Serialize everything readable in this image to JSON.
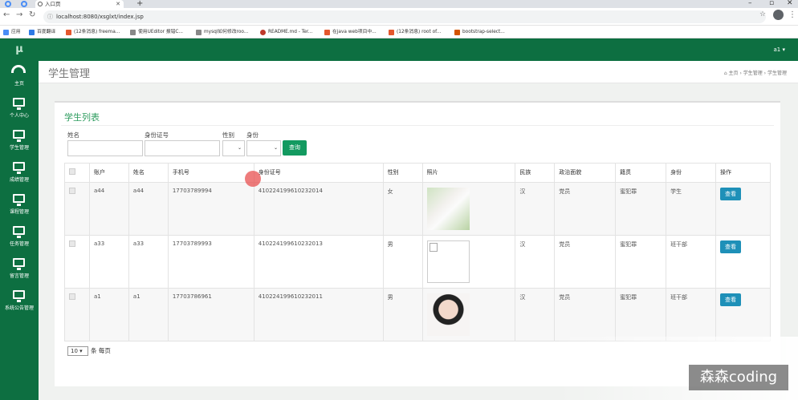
{
  "browser": {
    "tab_title": "入口页",
    "url": "localhost:8080/xsglxt/index.jsp",
    "bookmarks": [
      "应用",
      "百度翻译",
      "(12条消息) freema...",
      "使用UEditor 报错C...",
      "mysql如何修改roo...",
      "README.md - Ter...",
      "在java web项目中...",
      "(12条消息) root of...",
      "bootstrap-select..."
    ]
  },
  "app": {
    "logo": "μ",
    "user": "a1 ▾"
  },
  "sidebar": {
    "items": [
      {
        "label": "主页",
        "icon": "dashboard-icon"
      },
      {
        "label": "个人中心",
        "icon": "monitor-icon"
      },
      {
        "label": "学生管理",
        "icon": "monitor-icon"
      },
      {
        "label": "成绩管理",
        "icon": "monitor-icon"
      },
      {
        "label": "课程管理",
        "icon": "monitor-icon"
      },
      {
        "label": "任务管理",
        "icon": "monitor-icon"
      },
      {
        "label": "留言管理",
        "icon": "monitor-icon"
      },
      {
        "label": "系统公告管理",
        "icon": "monitor-icon"
      }
    ]
  },
  "page": {
    "title": "学生管理",
    "breadcrumb": "⌂ 主页  ›  学生管理  ›  学生管理"
  },
  "panel": {
    "title": "学生列表",
    "filters": {
      "name_label": "姓名",
      "idcard_label": "身份证号",
      "gender_label": "性别",
      "identity_label": "身份",
      "search_button": "查询"
    },
    "columns": [
      "账户",
      "姓名",
      "手机号",
      "身份证号",
      "性别",
      "照片",
      "民族",
      "政治面貌",
      "籍贯",
      "身份",
      "操作"
    ],
    "rows": [
      {
        "account": "a44",
        "name": "a44",
        "phone": "17703789994",
        "idcard": "410224199610232014",
        "gender": "女",
        "photo": "portrait-flowers",
        "ethnic": "汉",
        "political": "党员",
        "origin": "蜜犯罪",
        "identity": "学生",
        "action": "查看"
      },
      {
        "account": "a33",
        "name": "a33",
        "phone": "17703789993",
        "idcard": "410224199610232013",
        "gender": "男",
        "photo": "broken-image",
        "ethnic": "汉",
        "political": "党员",
        "origin": "蜜犯罪",
        "identity": "班干部",
        "action": "查看"
      },
      {
        "account": "a1",
        "name": "a1",
        "phone": "17703786961",
        "idcard": "410224199610232011",
        "gender": "男",
        "photo": "portrait-woman",
        "ethnic": "汉",
        "political": "党员",
        "origin": "蜜犯罪",
        "identity": "班干部",
        "action": "查看"
      }
    ],
    "pager": {
      "page_size": "10",
      "suffix": "条 每页"
    }
  },
  "watermark": "森森coding",
  "colors": {
    "brand_green": "#0d6f41",
    "accent_green": "#139a60",
    "view_button": "#1e90b8"
  }
}
